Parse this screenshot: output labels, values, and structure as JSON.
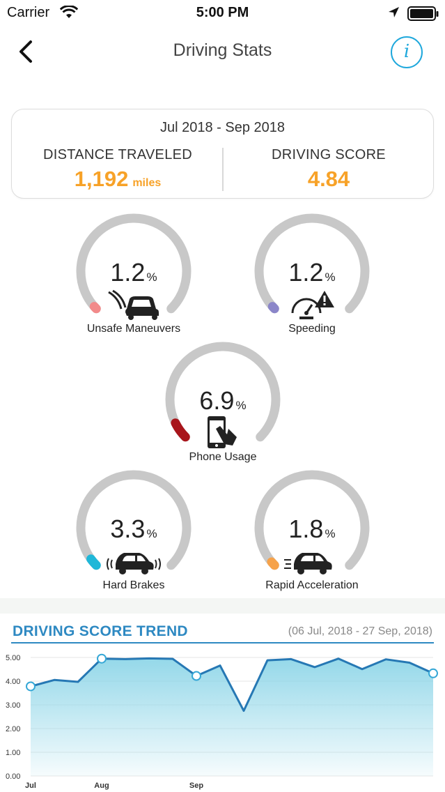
{
  "status_bar": {
    "carrier": "Carrier",
    "time": "5:00 PM"
  },
  "nav": {
    "title": "Driving Stats",
    "info_label": "i"
  },
  "summary": {
    "period": "Jul 2018 - Sep 2018",
    "distance_label": "DISTANCE TRAVELED",
    "distance_value": "1,192",
    "distance_unit": "miles",
    "score_label": "DRIVING SCORE",
    "score_value": "4.84",
    "accent_color": "#f7a228"
  },
  "gauges": [
    {
      "key": "unsafe",
      "label": "Unsafe Maneuvers",
      "value": "1.2",
      "unit": "%",
      "percent": 1.2,
      "color": "#f28a8a",
      "icon": "swerving-car-icon"
    },
    {
      "key": "speeding",
      "label": "Speeding",
      "value": "1.2",
      "unit": "%",
      "percent": 1.2,
      "color": "#8b86c9",
      "icon": "speedometer-warning-icon"
    },
    {
      "key": "phone",
      "label": "Phone Usage",
      "value": "6.9",
      "unit": "%",
      "percent": 6.9,
      "color": "#a8151b",
      "icon": "phone-touch-icon"
    },
    {
      "key": "brakes",
      "label": "Hard Brakes",
      "value": "3.3",
      "unit": "%",
      "percent": 3.3,
      "color": "#1fb7d8",
      "icon": "braking-car-icon"
    },
    {
      "key": "accel",
      "label": "Rapid Acceleration",
      "value": "1.8",
      "unit": "%",
      "percent": 1.8,
      "color": "#f6a24a",
      "icon": "accelerating-car-icon"
    }
  ],
  "trend": {
    "title": "DRIVING SCORE TREND",
    "range": "(06 Jul, 2018 - 27 Sep, 2018)"
  },
  "chart_data": {
    "type": "area",
    "title": "DRIVING SCORE TREND",
    "ylim": [
      0,
      5
    ],
    "yticks": [
      "0.00",
      "1.00",
      "2.00",
      "3.00",
      "4.00",
      "5.00"
    ],
    "x_labels": [
      {
        "label": "Jul",
        "index": 0
      },
      {
        "label": "Aug",
        "index": 3
      },
      {
        "label": "Sep",
        "index": 7
      }
    ],
    "values": [
      3.78,
      4.05,
      3.97,
      4.95,
      4.93,
      4.96,
      4.94,
      4.22,
      4.66,
      2.75,
      4.88,
      4.93,
      4.59,
      4.95,
      4.51,
      4.92,
      4.78,
      4.33
    ],
    "markers": [
      0,
      3,
      7,
      17
    ],
    "line_color": "#2678b4",
    "fill_color": "#8fd6e8",
    "grid": true
  }
}
